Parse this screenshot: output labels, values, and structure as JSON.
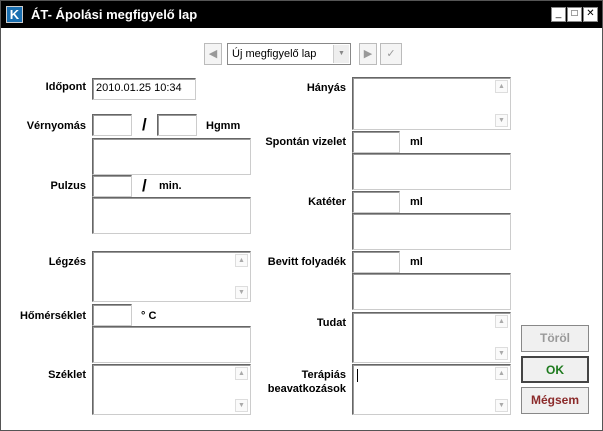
{
  "window": {
    "title": "ÁT- Ápolási megfigyelő lap",
    "app_icon": "K",
    "minimize_glyph": "_",
    "maximize_glyph": "□",
    "close_glyph": "✕"
  },
  "nav": {
    "prev_glyph": "◀",
    "next_glyph": "▶",
    "confirm_glyph": "✓",
    "combo_value": "Új megfigyelő lap",
    "dropdown_glyph": "▼"
  },
  "left": {
    "idopont_label": "Időpont",
    "idopont_value": "2010.01.25 10:34",
    "vernyomas_label": "Vérnyomás",
    "vernyomas_slash": "/",
    "vernyomas_unit": "Hgmm",
    "pulzus_label": "Pulzus",
    "pulzus_slash": "/",
    "pulzus_unit": "min.",
    "legzes_label": "Légzés",
    "homerseklet_label": "Hőmérséklet",
    "homerseklet_unit": "° C",
    "szeklet_label": "Széklet"
  },
  "right": {
    "hanyas_label": "Hányás",
    "spontan_label": "Spontán vizelet",
    "spontan_unit": "ml",
    "kateter_label": "Katéter",
    "kateter_unit": "ml",
    "bevitt_label": "Bevitt folyadék",
    "bevitt_unit": "ml",
    "tudat_label": "Tudat",
    "terapias_label_1": "Terápiás",
    "terapias_label_2": "beavatkozások"
  },
  "scroll": {
    "up_glyph": "▲",
    "down_glyph": "▼"
  },
  "buttons": {
    "torol": "Töröl",
    "ok": "OK",
    "megsem": "Mégsem"
  },
  "colors": {
    "titlebar": "#000000",
    "ok_text": "#1e7a1e",
    "megsem_text": "#8b2a2a",
    "torol_text": "#999999"
  }
}
